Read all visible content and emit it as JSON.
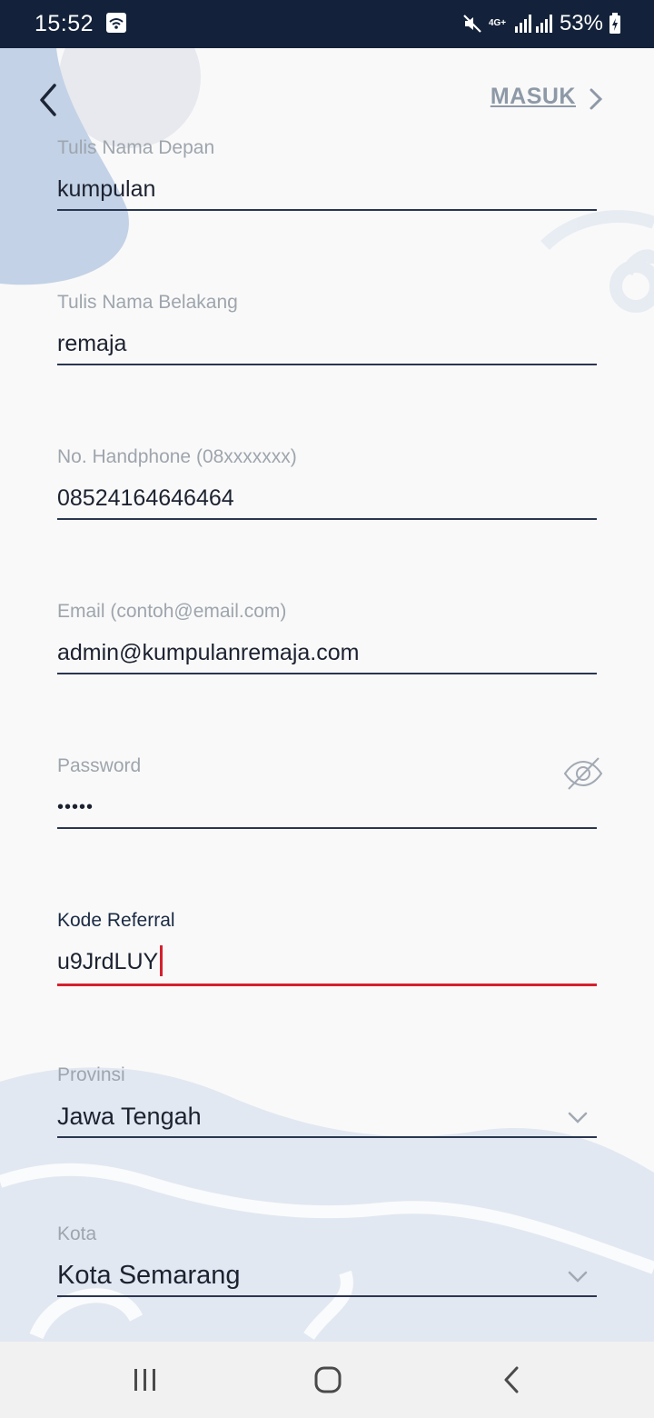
{
  "status_bar": {
    "time": "15:52",
    "network": "4G+",
    "battery": "53%",
    "icons": [
      "wifi-icon",
      "mute-icon",
      "signal-icon",
      "battery-icon"
    ]
  },
  "header": {
    "login_link": "MASUK",
    "icons": [
      "back-icon",
      "chevron-right-icon"
    ]
  },
  "form": {
    "first_name": {
      "label": "Tulis Nama Depan",
      "value": "kumpulan"
    },
    "last_name": {
      "label": "Tulis Nama Belakang",
      "value": "remaja"
    },
    "phone": {
      "label": "No. Handphone (08xxxxxxx)",
      "value": "08524164646464"
    },
    "email": {
      "label": "Email (contoh@email.com)",
      "value": "admin@kumpulanremaja.com"
    },
    "password": {
      "label": "Password",
      "value": "•••••"
    },
    "referral": {
      "label": "Kode Referral",
      "value": "u9JrdLUY"
    },
    "province": {
      "label": "Provinsi",
      "value": "Jawa Tengah"
    },
    "city": {
      "label": "Kota",
      "value": "Kota Semarang"
    }
  },
  "colors": {
    "status_bar": "#13223a",
    "background": "#f9f9f9",
    "accent_error": "#d5202e",
    "decoration": "#c5d3e6"
  },
  "navigation_bar": {
    "icons": [
      "recent-apps-icon",
      "home-icon",
      "nav-back-icon"
    ]
  }
}
